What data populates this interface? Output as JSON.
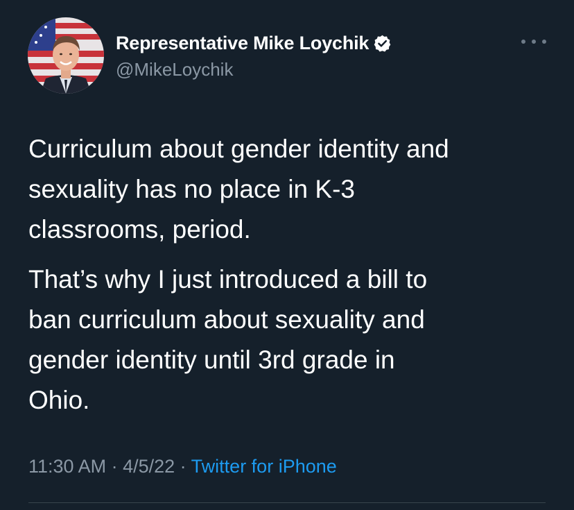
{
  "author": {
    "display_name": "Representative Mike Loychik",
    "handle": "@MikeLoychik",
    "verified": true,
    "avatar": "avatar-photo"
  },
  "tweet": {
    "paragraphs": [
      "Curriculum about gender identity and\nsexuality has no place in K-3\nclassrooms, period.",
      "That’s why I just introduced a bill to\nban curriculum about sexuality and\ngender identity until 3rd grade in\nOhio."
    ]
  },
  "meta": {
    "time": "11:30 AM",
    "sep1": " · ",
    "date": "4/5/22",
    "sep2": " · ",
    "source": "Twitter for iPhone"
  },
  "icons": {
    "verified": "verified-badge-icon",
    "more": "more-options-icon"
  },
  "colors": {
    "background": "#15202b",
    "text": "#ffffff",
    "secondary": "#8b98a5",
    "link": "#1d9bf0"
  }
}
